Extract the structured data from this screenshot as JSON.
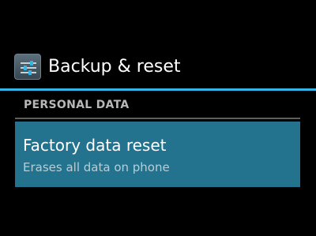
{
  "action_bar": {
    "icon": "settings-sliders-icon",
    "title": "Backup & reset"
  },
  "accent_color": "#33b5e5",
  "sections": [
    {
      "header": "PERSONAL DATA",
      "items": [
        {
          "title": "Factory data reset",
          "summary": "Erases all data on phone",
          "highlight_color": "#23738f"
        }
      ]
    }
  ]
}
